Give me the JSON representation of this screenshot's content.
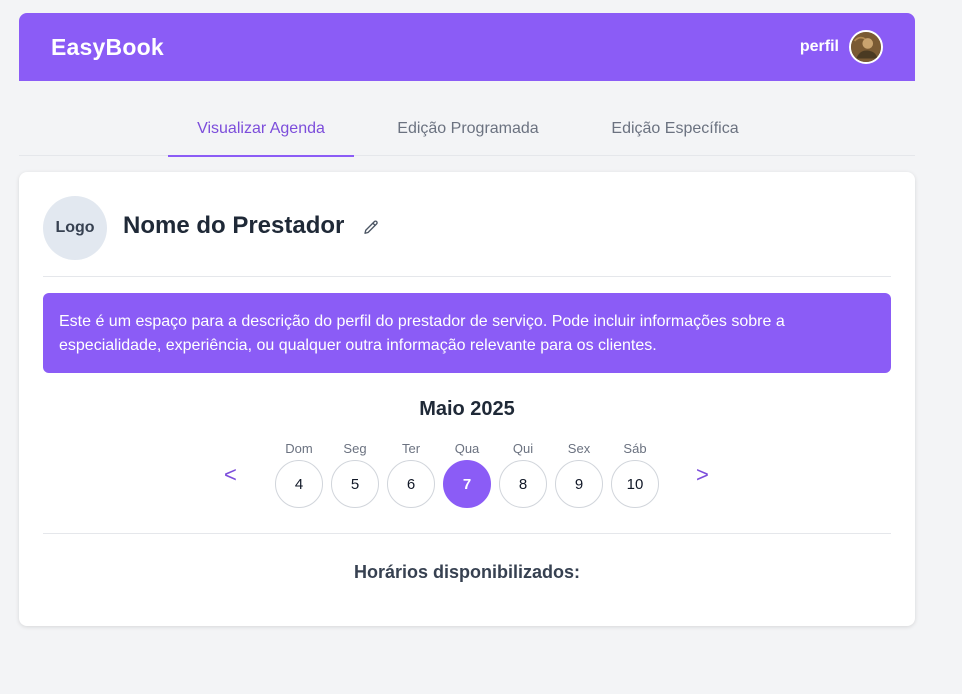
{
  "header": {
    "brand": "EasyBook",
    "profile_label": "perfil",
    "accent_color": "#8b5cf6"
  },
  "tabs": [
    {
      "label": "Visualizar Agenda",
      "active": true
    },
    {
      "label": "Edição Programada",
      "active": false
    },
    {
      "label": "Edição Específica",
      "active": false
    }
  ],
  "provider": {
    "logo_text": "Logo",
    "name": "Nome do Prestador",
    "description": "Este é um espaço para a descrição do perfil do prestador de serviço. Pode incluir informações sobre a especialidade, experiência, ou qualquer outra informação relevante para os clientes."
  },
  "calendar": {
    "month": "Maio 2025",
    "prev_label": "<",
    "next_label": ">",
    "days": [
      {
        "name": "Dom",
        "number": "4",
        "selected": false
      },
      {
        "name": "Seg",
        "number": "5",
        "selected": false
      },
      {
        "name": "Ter",
        "number": "6",
        "selected": false
      },
      {
        "name": "Qua",
        "number": "7",
        "selected": true
      },
      {
        "name": "Qui",
        "number": "8",
        "selected": false
      },
      {
        "name": "Sex",
        "number": "9",
        "selected": false
      },
      {
        "name": "Sáb",
        "number": "10",
        "selected": false
      }
    ]
  },
  "slots": {
    "title": "Horários disponibilizados:"
  }
}
